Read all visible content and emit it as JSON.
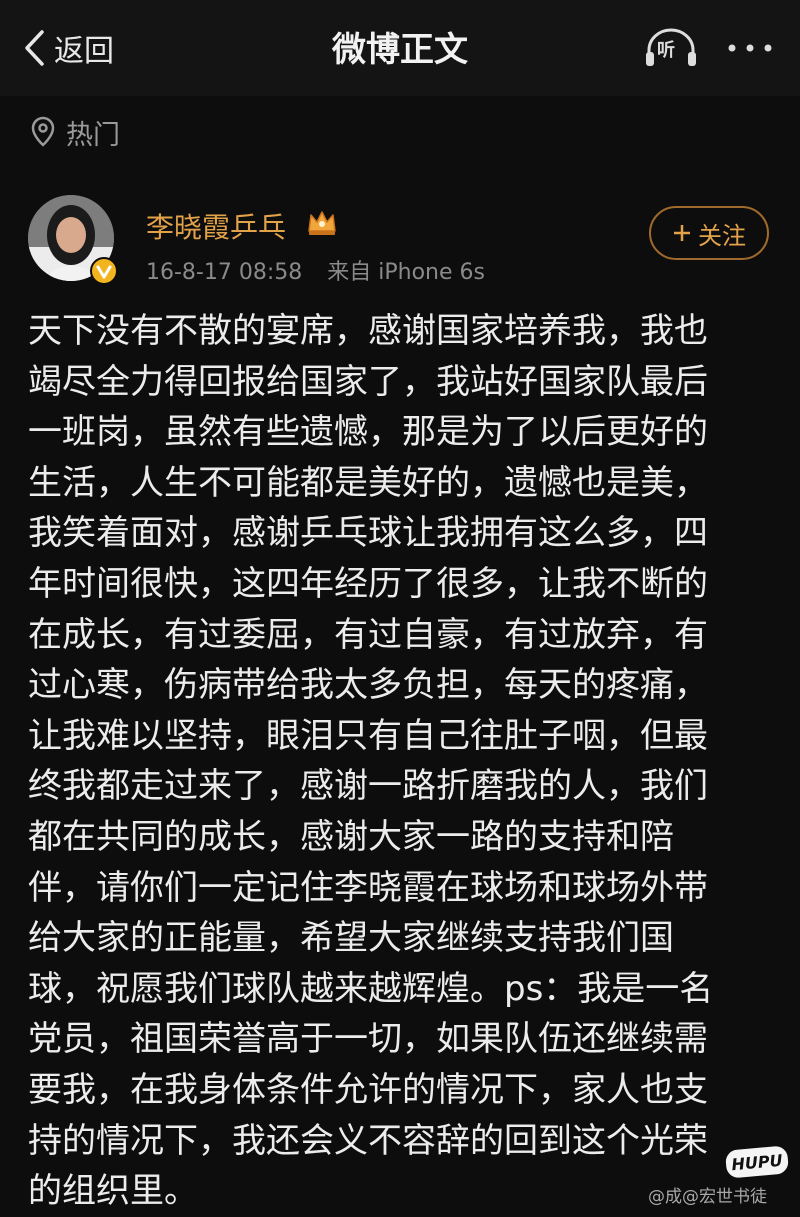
{
  "nav": {
    "back_label": "返回",
    "title": "微博正文",
    "listen_label": "听"
  },
  "hot": {
    "label": "热门"
  },
  "post": {
    "username": "李晓霞乒乓",
    "date": "16-8-17 08:58",
    "source": "来自 iPhone 6s",
    "follow_label": "关注",
    "lines": [
      "天下没有不散的宴席，感谢国家培养我，我也",
      "竭尽全力得回报给国家了，我站好国家队最后",
      "一班岗，虽然有些遗憾，那是为了以后更好的",
      "生活，人生不可能都是美好的，遗憾也是美，",
      "我笑着面对，感谢乒乓球让我拥有这么多，四",
      "年时间很快，这四年经历了很多，让我不断的",
      "在成长，有过委屈，有过自豪，有过放弃，有",
      "过心寒，伤病带给我太多负担，每天的疼痛，",
      "让我难以坚持，眼泪只有自己往肚子咽，但最",
      "终我都走过来了，感谢一路折磨我的人，我们",
      "都在共同的成长，感谢大家一路的支持和陪",
      "伴，请你们一定记住李晓霞在球场和球场外带",
      "给大家的正能量，希望大家继续支持我们国",
      "球，祝愿我们球队越来越辉煌。ps：我是一名",
      "党员，祖国荣誉高于一切，如果队伍还继续需",
      "要我，在我身体条件允许的情况下，家人也支",
      "持的情况下，我还会义不容辞的回到这个光荣",
      "的组织里。"
    ]
  },
  "watermark": {
    "logo": "HUPU",
    "text": "@成@宏世书徒"
  },
  "colors": {
    "accent": "#e2a24a",
    "background": "#0d0d0d",
    "text": "#ececec",
    "meta": "#8a8a8a"
  },
  "icons": [
    "back-chevron-icon",
    "listen-headphones-icon",
    "more-dots-icon",
    "location-pin-icon",
    "verified-v-icon",
    "crown-icon"
  ]
}
